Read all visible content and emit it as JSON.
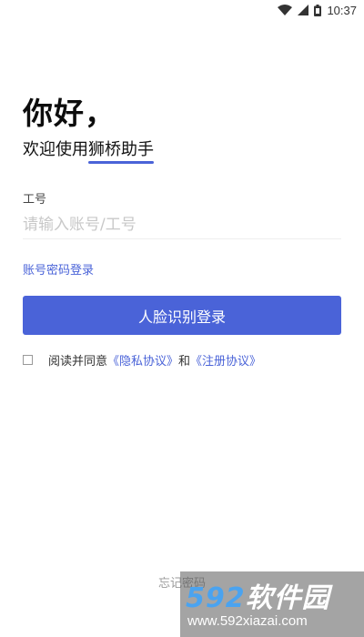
{
  "status_bar": {
    "time": "10:37",
    "icons": [
      "wifi-icon",
      "signal-icon",
      "battery-icon"
    ]
  },
  "header": {
    "greeting": "你好，",
    "welcome_prefix": "欢迎使用",
    "app_name": "狮桥助手"
  },
  "form": {
    "field_label": "工号",
    "field_placeholder": "请输入账号/工号",
    "field_value": "",
    "account_login_link": "账号密码登录",
    "login_button": "人脸识别登录"
  },
  "agreement": {
    "checked": false,
    "prefix": "阅读并同意",
    "privacy_link": "《隐私协议》",
    "conjunction": "和",
    "register_link": "《注册协议》"
  },
  "footer": {
    "forgot_password": "忘记密码"
  },
  "watermark": {
    "brand_number": "592",
    "brand_text": "软件园",
    "url": "www.592xiazai.com"
  },
  "colors": {
    "accent": "#4a63d8",
    "text": "#111111",
    "muted": "#9a9a9a",
    "placeholder": "#c8c8c8"
  }
}
